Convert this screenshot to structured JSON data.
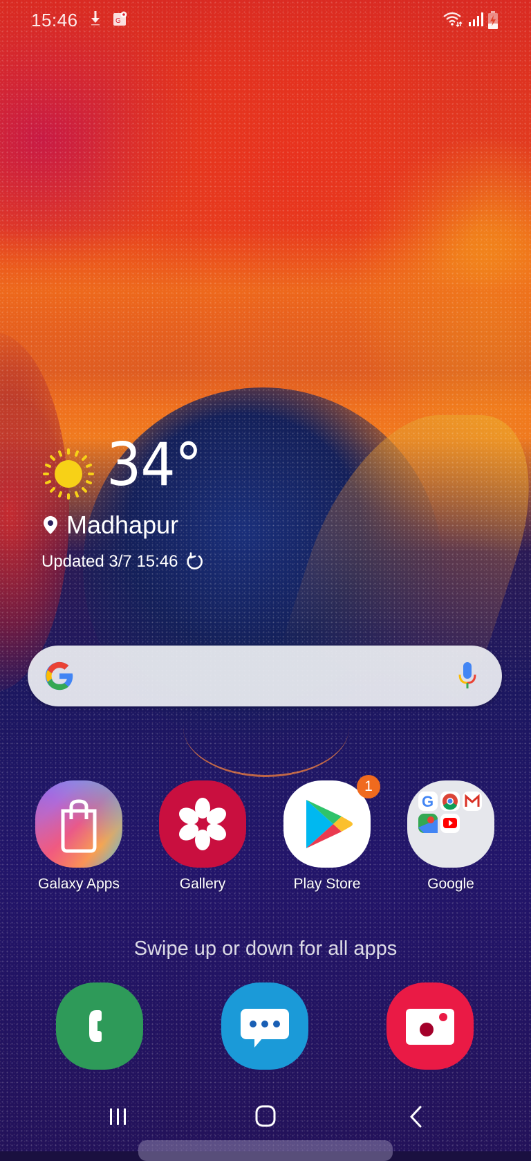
{
  "status_bar": {
    "time": "15:46",
    "notification_icons": [
      "download-icon",
      "google-maps-icon"
    ],
    "system_icons": [
      "wifi-icon",
      "signal-icon",
      "battery-charging-icon"
    ]
  },
  "weather": {
    "condition_icon": "sun-icon",
    "temperature": "34°",
    "location": "Madhapur",
    "updated": "Updated 3/7 15:46",
    "refresh_icon": "refresh-icon"
  },
  "search": {
    "logo": "google-g-icon",
    "voice_icon": "mic-icon",
    "value": ""
  },
  "apps": [
    {
      "label": "Galaxy Apps",
      "icon": "shopping-bag-icon"
    },
    {
      "label": "Gallery",
      "icon": "flower-icon"
    },
    {
      "label": "Play Store",
      "icon": "play-triangle-icon",
      "badge": "1"
    },
    {
      "label": "Google",
      "icon": "folder-icon",
      "folder_contents": [
        "Google",
        "Chrome",
        "Gmail",
        "Maps",
        "YouTube"
      ]
    }
  ],
  "hint": "Swipe up or down for all apps",
  "dock": [
    {
      "name": "Phone",
      "icon": "phone-icon"
    },
    {
      "name": "Messages",
      "icon": "message-icon"
    },
    {
      "name": "Camera",
      "icon": "camera-icon"
    }
  ],
  "nav": {
    "recent": "recent-apps",
    "home": "home",
    "back": "back"
  },
  "colors": {
    "badge": "#f06a1e",
    "gallery": "#c90f3f",
    "phone": "#2e9a59",
    "messages": "#1b9ad8",
    "camera": "#ea1a45",
    "sun": "#f7d117"
  }
}
